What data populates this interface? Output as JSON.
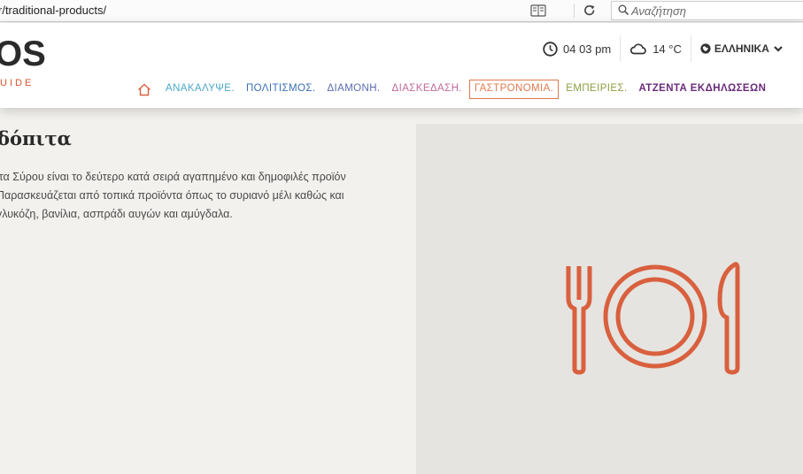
{
  "browser": {
    "url": "r/traditional-products/",
    "search_placeholder": "Αναζήτηση"
  },
  "header": {
    "logo_text": "OS",
    "logo_subtitle": "UIDE",
    "time": "04 03 pm",
    "weather": "14 °C",
    "language": "ΕΛΛΗΝΙΚΑ"
  },
  "nav": {
    "items": [
      {
        "label": "ΑΝΑΚΑΛΥΨΕ.",
        "color": "#4aa8c8"
      },
      {
        "label": "ΠΟΛΙΤΙΣΜΟΣ.",
        "color": "#3a6fb5"
      },
      {
        "label": "ΔΙΑΜΟΝΗ.",
        "color": "#5b6bb0"
      },
      {
        "label": "ΔΙΑΣΚΕΔΑΣΗ.",
        "color": "#c06a9a"
      },
      {
        "label": "ΓΑΣΤΡΟΝΟΜΙΑ.",
        "color": "#e2784d"
      },
      {
        "label": "ΕΜΠΕΙΡΙΕΣ.",
        "color": "#8aa040"
      },
      {
        "label": "ΑΤΖΕΝΤΑ ΕΚΔΗΛΩΣΕΩΝ",
        "color": "#6a2c7a"
      }
    ]
  },
  "content": {
    "title": "δόπιτα",
    "paragraph_lines": [
      "ιτα Σύρου είναι το δεύτερο κατά σειρά αγαπημένο και δημοφιλές προϊόν",
      "Παρασκευάζεται από τοπικά προϊόντα όπως το συριανό μέλι καθώς και",
      "γλυκόζη, βανίλια, ασπράδι αυγών και αμύγδαλα."
    ]
  },
  "colors": {
    "accent": "#d9542f",
    "icon_color": "#d9603e",
    "header_bg": "#ffffff",
    "page_bg": "#f2f1ee",
    "image_bg": "#e5e4e0"
  }
}
